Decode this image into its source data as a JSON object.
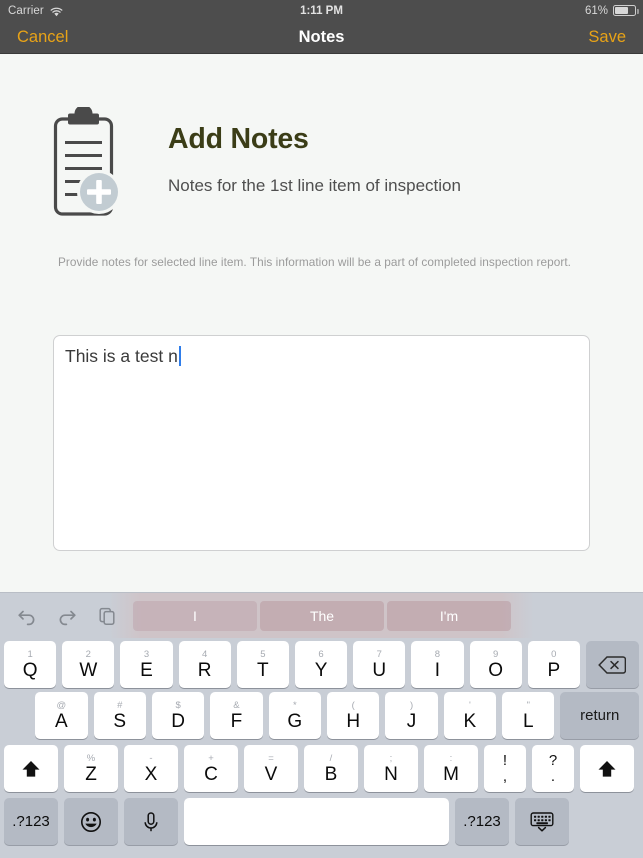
{
  "status_bar": {
    "carrier": "Carrier",
    "wifi_icon": "wifi-icon",
    "time": "1:11 PM",
    "battery_percent": "61%",
    "battery_icon": "battery-icon"
  },
  "nav_bar": {
    "cancel_label": "Cancel",
    "title": "Notes",
    "save_label": "Save",
    "accent_color": "#e8a317",
    "background_color": "#4d4d4d"
  },
  "content": {
    "icon_name": "clipboard-add-icon",
    "heading": "Add Notes",
    "heading_color": "#3b3d17",
    "subheading": "Notes for the 1st line item of inspection",
    "helper_text": "Provide notes for selected line item. This information will be a part of completed inspection report.",
    "notes_field": {
      "value": "This is a test n",
      "placeholder": "",
      "caret_color": "#2f7dea"
    }
  },
  "keyboard": {
    "toolbar": {
      "undo_icon": "undo-icon",
      "redo_icon": "redo-icon",
      "paste_icon": "paste-icon"
    },
    "suggestions": [
      "I",
      "The",
      "I'm"
    ],
    "rows": [
      [
        {
          "main": "Q",
          "alt": "1"
        },
        {
          "main": "W",
          "alt": "2"
        },
        {
          "main": "E",
          "alt": "3"
        },
        {
          "main": "R",
          "alt": "4"
        },
        {
          "main": "T",
          "alt": "5"
        },
        {
          "main": "Y",
          "alt": "6"
        },
        {
          "main": "U",
          "alt": "7"
        },
        {
          "main": "I",
          "alt": "8"
        },
        {
          "main": "O",
          "alt": "9"
        },
        {
          "main": "P",
          "alt": "0"
        }
      ],
      [
        {
          "main": "A",
          "alt": "@"
        },
        {
          "main": "S",
          "alt": "#"
        },
        {
          "main": "D",
          "alt": "$"
        },
        {
          "main": "F",
          "alt": "&"
        },
        {
          "main": "G",
          "alt": "*"
        },
        {
          "main": "H",
          "alt": "("
        },
        {
          "main": "J",
          "alt": ")"
        },
        {
          "main": "K",
          "alt": "'"
        },
        {
          "main": "L",
          "alt": "\""
        }
      ],
      [
        {
          "main": "Z",
          "alt": "%"
        },
        {
          "main": "X",
          "alt": "-"
        },
        {
          "main": "C",
          "alt": "+"
        },
        {
          "main": "V",
          "alt": "="
        },
        {
          "main": "B",
          "alt": "/"
        },
        {
          "main": "N",
          "alt": ";"
        },
        {
          "main": "M",
          "alt": ":"
        }
      ]
    ],
    "punct_keys": [
      {
        "top": "!",
        "bot": ","
      },
      {
        "top": "?",
        "bot": "."
      }
    ],
    "backspace_icon": "backspace-icon",
    "return_label": "return",
    "shift_icon": "shift-icon",
    "numeric_label_left": ".?123",
    "numeric_label_right": ".?123",
    "emoji_icon": "emoji-icon",
    "mic_icon": "microphone-icon",
    "hide_keyboard_icon": "hide-keyboard-icon",
    "space_label": ""
  }
}
